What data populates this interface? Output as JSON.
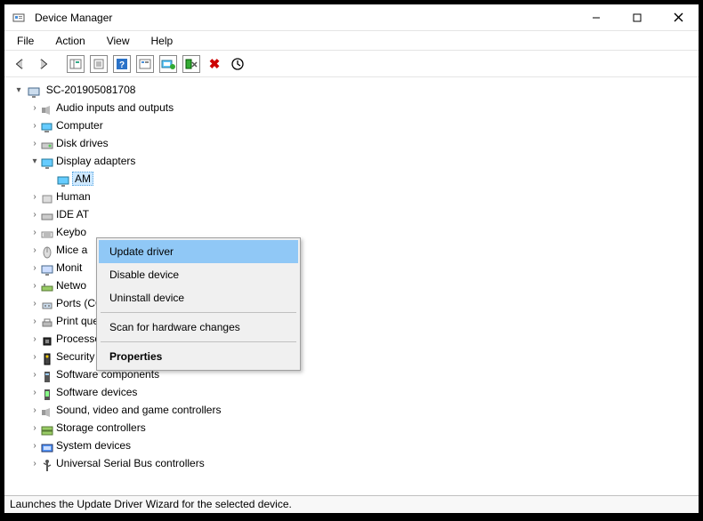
{
  "window": {
    "title": "Device Manager"
  },
  "menu": {
    "file": "File",
    "action": "Action",
    "view": "View",
    "help": "Help"
  },
  "tree": {
    "root": "SC-201905081708",
    "items": [
      "Audio inputs and outputs",
      "Computer",
      "Disk drives",
      "Display adapters",
      "Human",
      "IDE AT",
      "Keybo",
      "Mice a",
      "Monit",
      "Netwo",
      "Ports (COM & LPT)",
      "Print queues",
      "Processors",
      "Security devices",
      "Software components",
      "Software devices",
      "Sound, video and game controllers",
      "Storage controllers",
      "System devices",
      "Universal Serial Bus controllers"
    ],
    "selected_child": "AM"
  },
  "context_menu": {
    "items": [
      "Update driver",
      "Disable device",
      "Uninstall device",
      "Scan for hardware changes",
      "Properties"
    ]
  },
  "statusbar": "Launches the Update Driver Wizard for the selected device."
}
